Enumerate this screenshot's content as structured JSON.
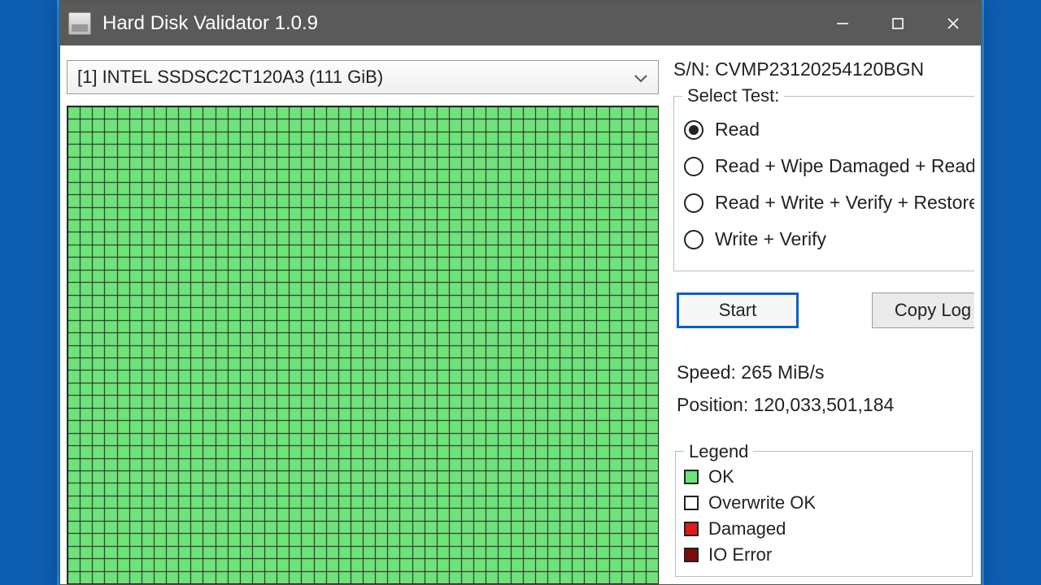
{
  "window": {
    "title": "Hard Disk Validator 1.0.9"
  },
  "disk": {
    "selected_label": "[1] INTEL SSDSC2CT120A3 (111 GiB)",
    "serial_prefix": "S/N:",
    "serial": "CVMP23120254120BGN"
  },
  "test": {
    "group_label": "Select Test:",
    "options": [
      {
        "label": "Read",
        "checked": true
      },
      {
        "label": "Read + Wipe Damaged + Read",
        "checked": false
      },
      {
        "label": "Read + Write + Verify + Restore",
        "checked": false
      },
      {
        "label": "Write + Verify",
        "checked": false
      }
    ]
  },
  "buttons": {
    "start": "Start",
    "copy_log": "Copy Log"
  },
  "stats": {
    "speed_label": "Speed:",
    "speed_value": "265 MiB/s",
    "position_label": "Position:",
    "position_value": "120,033,501,184"
  },
  "legend": {
    "group_label": "Legend",
    "items": [
      {
        "key": "ok",
        "label": "OK"
      },
      {
        "key": "ow",
        "label": "Overwrite OK"
      },
      {
        "key": "dmg",
        "label": "Damaged"
      },
      {
        "key": "ioe",
        "label": "IO Error"
      }
    ]
  },
  "block_map": {
    "cols": 48,
    "rows": 38,
    "status": "all_ok"
  }
}
